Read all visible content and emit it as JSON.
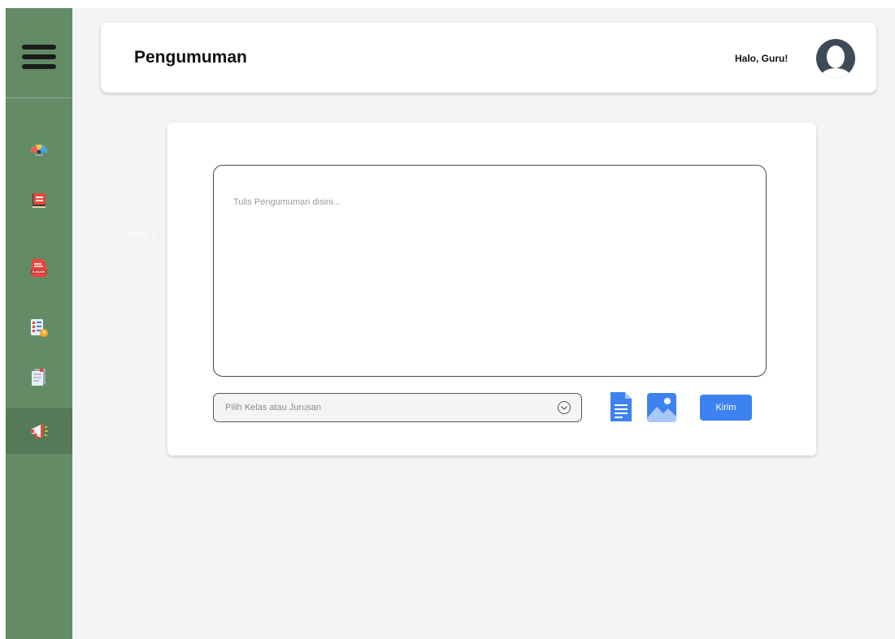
{
  "sidebar": {
    "items": [
      {
        "icon": "dashboard-icon"
      },
      {
        "icon": "book-icon"
      },
      {
        "icon": "ebook-icon",
        "badge": "E-BOOK"
      },
      {
        "icon": "task-icon"
      },
      {
        "icon": "document-icon"
      },
      {
        "icon": "megaphone-icon",
        "active": true
      }
    ],
    "ghost_text": "Senin 1"
  },
  "header": {
    "title": "Pengumuman",
    "greeting": "Halo, Guru!"
  },
  "announcement": {
    "textarea_placeholder": "Tulis Pengumuman disini...",
    "select_placeholder": "Pilih Kelas atau Jurusan",
    "send_label": "Kirim"
  },
  "colors": {
    "sidebar": "#628b66",
    "accent": "#3d82f1",
    "background": "#f3f4f4"
  }
}
